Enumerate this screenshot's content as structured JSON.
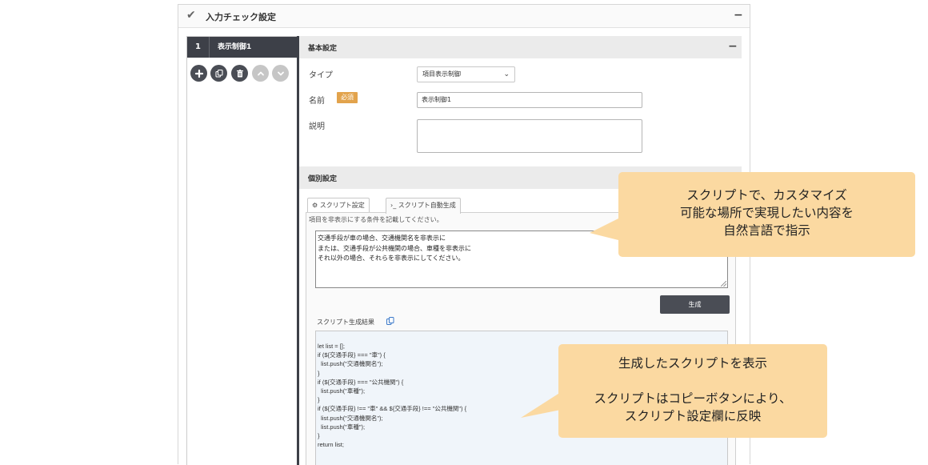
{
  "panel": {
    "title": "入力チェック設定",
    "collapse_glyph": "−"
  },
  "left": {
    "item_number": "1",
    "item_name": "表示制御1",
    "actions": [
      "add-icon",
      "copy-icon",
      "delete-icon",
      "move-up-icon",
      "move-down-icon"
    ]
  },
  "basic": {
    "title": "基本設定",
    "collapse_glyph": "−",
    "type_label": "タイプ",
    "type_value": "項目表示制御",
    "name_label": "名前",
    "required_badge": "必須",
    "name_value": "表示制御1",
    "desc_label": "説明",
    "desc_value": ""
  },
  "individual": {
    "title": "個別設定",
    "tabs": [
      {
        "label": "スクリプト設定",
        "icon": "gear-icon"
      },
      {
        "label": "スクリプト自動生成",
        "icon": "terminal-icon"
      }
    ],
    "hint": "項目を非表示にする条件を記載してください。",
    "prompt_lines": [
      "交通手段が車の場合、交通機関名を非表示に",
      "または、交通手段が公共機関の場合、車種を非表示に",
      "それ以外の場合、それらを非表示にしてください。"
    ],
    "generate_label": "生成",
    "result_label": "スクリプト生成結果",
    "code_lines": [
      "let list = [];",
      "if (${交通手段} === \"車\") {",
      "  list.push(\"交通機関名\");",
      "}",
      "if (${交通手段} === \"公共機関\") {",
      "  list.push(\"車種\");",
      "}",
      "if (${交通手段} !== \"車\" && ${交通手段} !== \"公共機関\") {",
      "  list.push(\"交通機関名\");",
      "  list.push(\"車種\");",
      "}",
      "return list;"
    ]
  },
  "callouts": {
    "top": [
      "スクリプトで、カスタマイズ",
      "可能な場所で実現したい内容を",
      "自然言語で指示"
    ],
    "bottom": [
      "生成したスクリプトを表示",
      "",
      "スクリプトはコピーボタンにより、",
      "スクリプト設定欄に反映"
    ]
  },
  "colors": {
    "dark": "#3d4048",
    "badge": "#e2a34c",
    "callout": "#fbd9a1",
    "result_bg": "#f0f5fa"
  }
}
